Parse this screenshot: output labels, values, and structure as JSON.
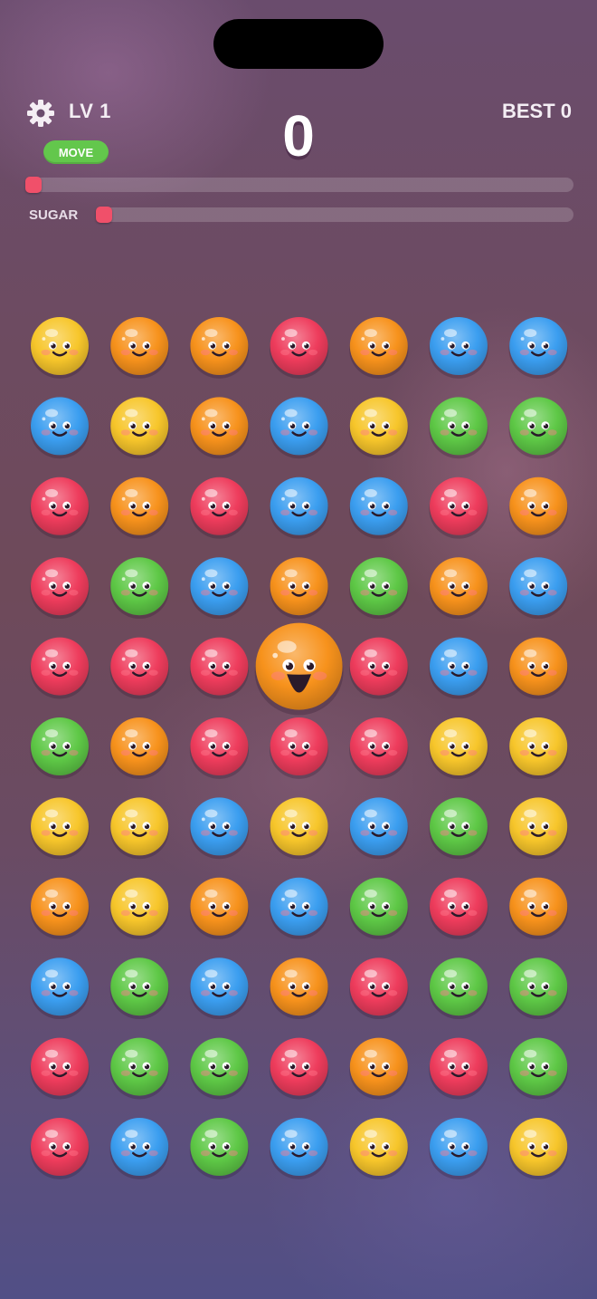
{
  "hud": {
    "level_label": "LV 1",
    "move_label": "MOVE",
    "score": "0",
    "best_label": "BEST 0",
    "sugar_label": "SUGAR",
    "progress_fraction": 0,
    "sugar_fraction": 0
  },
  "colors": {
    "yellow": "#f7c62b",
    "orange": "#f7921c",
    "red": "#ee3c5c",
    "blue": "#3b9ef0",
    "green": "#5ec846"
  },
  "icons": {
    "settings": "gear-icon"
  },
  "board": {
    "columns": 7,
    "rows": 11,
    "grid": [
      [
        "yellow",
        "orange",
        "orange",
        "red",
        "orange",
        "blue",
        "blue"
      ],
      [
        "blue",
        "yellow",
        "orange",
        "blue",
        "yellow",
        "green",
        "green"
      ],
      [
        "red",
        "orange",
        "red",
        "blue",
        "blue",
        "red",
        "orange"
      ],
      [
        "red",
        "green",
        "blue",
        "orange",
        "green",
        "orange",
        "blue"
      ],
      [
        "red",
        "red",
        "red",
        "orange",
        "red",
        "blue",
        "orange"
      ],
      [
        "green",
        "orange",
        "red",
        "red",
        "red",
        "yellow",
        "yellow"
      ],
      [
        "yellow",
        "yellow",
        "blue",
        "yellow",
        "blue",
        "green",
        "yellow"
      ],
      [
        "orange",
        "yellow",
        "orange",
        "blue",
        "green",
        "red",
        "orange"
      ],
      [
        "blue",
        "green",
        "blue",
        "orange",
        "red",
        "green",
        "green"
      ],
      [
        "red",
        "green",
        "green",
        "red",
        "orange",
        "red",
        "green"
      ],
      [
        "red",
        "blue",
        "green",
        "blue",
        "yellow",
        "blue",
        "yellow"
      ]
    ],
    "selected": {
      "row": 4,
      "col": 3
    }
  }
}
